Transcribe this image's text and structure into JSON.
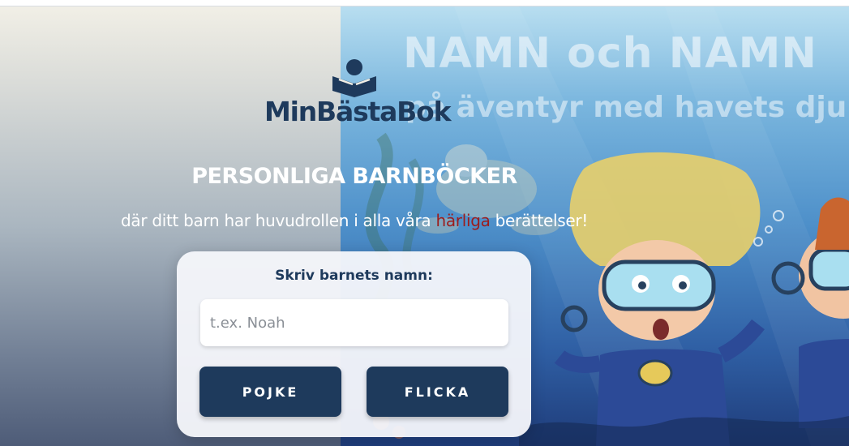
{
  "logo": {
    "text": "MinBästaBok",
    "icon": "reading-child-book-icon"
  },
  "cover": {
    "title": "NAMN och NAMN",
    "subtitle": "på äventyr med havets djur"
  },
  "hero": {
    "headline": "PERSONLIGA BARNBÖCKER",
    "tagline_before": "där ditt barn har huvudrollen i alla våra ",
    "tagline_highlight": "härliga",
    "tagline_after": " berättelser!"
  },
  "form": {
    "label": "Skriv barnets namn:",
    "name_placeholder": "t.ex. Noah",
    "name_value": "",
    "boy_button": "POJKE",
    "girl_button": "FLICKA"
  },
  "colors": {
    "brand_navy": "#1e3a5c",
    "highlight_red": "#9c1c1c",
    "card_bg": "#f6f7fb"
  }
}
